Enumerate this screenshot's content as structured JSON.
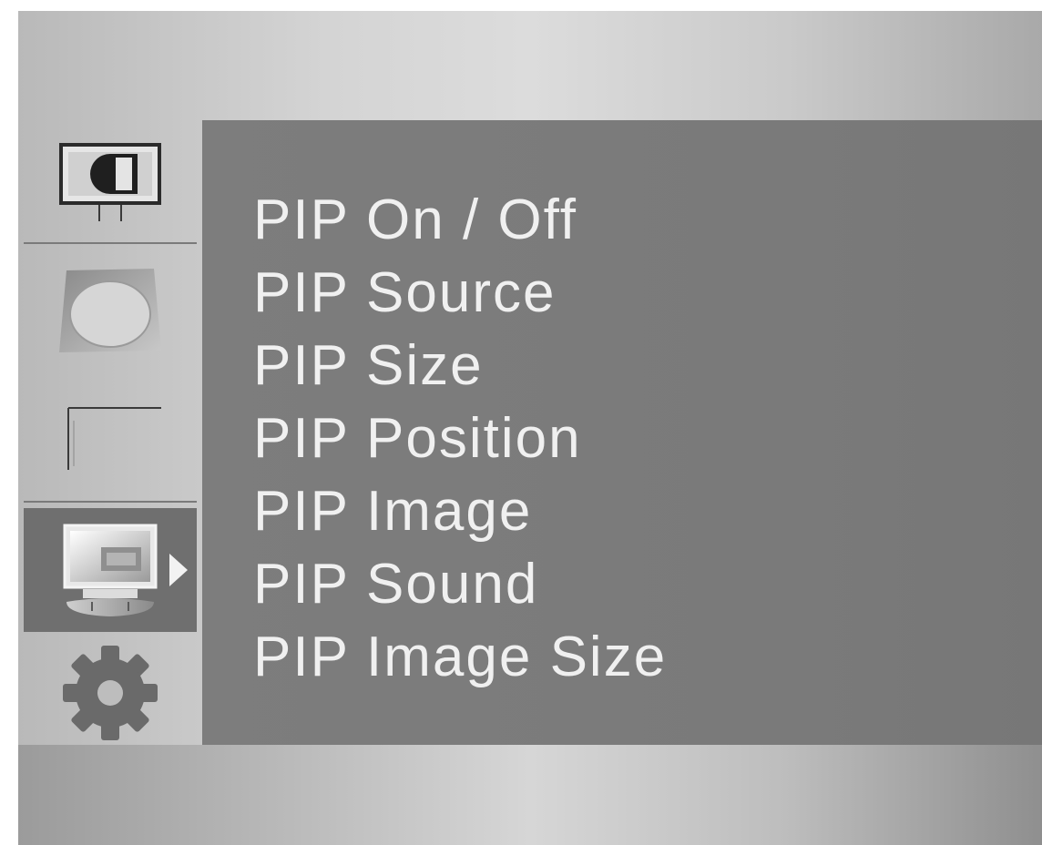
{
  "sidebar": {
    "tabs": [
      {
        "id": "picture",
        "icon": "picture-monitor-icon",
        "active": false
      },
      {
        "id": "geometry",
        "icon": "screen-geometry-icon",
        "active": false
      },
      {
        "id": "position",
        "icon": "screen-position-icon",
        "active": false
      },
      {
        "id": "pip",
        "icon": "pip-monitor-icon",
        "active": true
      },
      {
        "id": "setup",
        "icon": "gear-icon",
        "active": false
      }
    ],
    "active_indicator_icon": "triangle-right-icon"
  },
  "menu": {
    "items": [
      "PIP On / Off",
      "PIP Source",
      "PIP Size",
      "PIP Position",
      "PIP Image",
      "PIP Sound",
      "PIP Image Size"
    ]
  },
  "colors": {
    "panel": "#7a7a7a",
    "active_tab": "#6f6f6f",
    "menu_text": "#f0f0f0",
    "frame_light": "#dcdcdc",
    "frame_dark": "#a9a9a9"
  }
}
